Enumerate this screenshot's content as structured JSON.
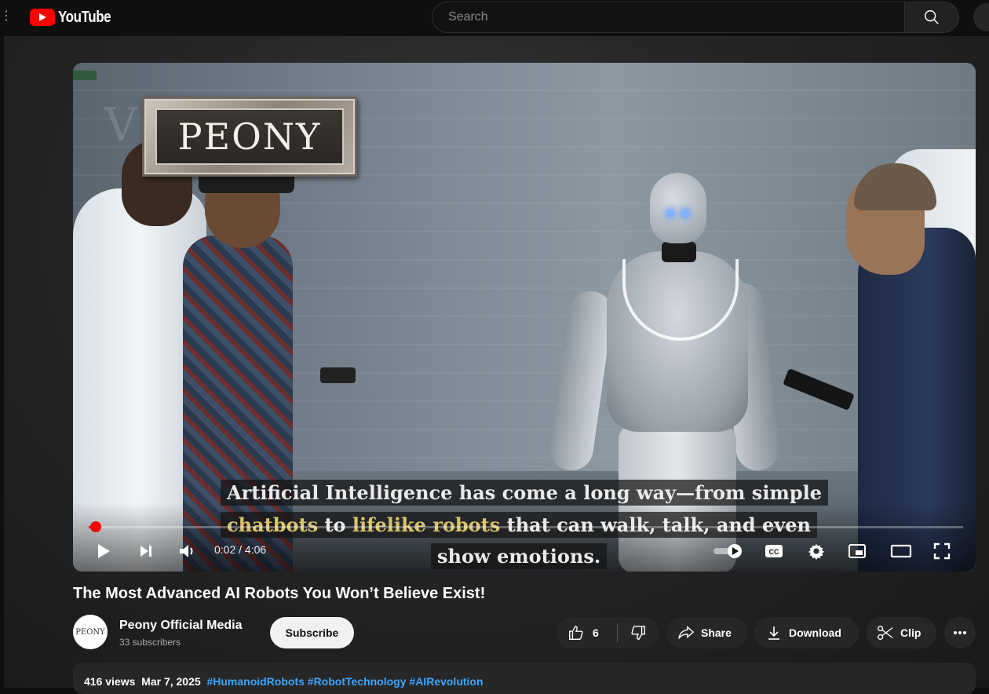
{
  "header": {
    "logo_text": "YouTube",
    "search_placeholder": "Search"
  },
  "video": {
    "overlay_logo_text": "PEONY",
    "captions": {
      "line1": "Artificial Intelligence has come a long way—from simple",
      "line2_part1": "chatbots",
      "line2_part2": " to ",
      "line2_part3": "lifelike robots",
      "line2_part4": " that can walk, talk, and even",
      "line3": "show emotions."
    },
    "time_display": "0:02 / 4:06",
    "progress_fraction": 0.008,
    "accent_color": "#ff0000"
  },
  "title": "The Most Advanced AI Robots You Won’t Believe Exist!",
  "channel": {
    "avatar_text": "PEONY",
    "name": "Peony Official Media",
    "subscribers": "33 subscribers",
    "subscribe_label": "Subscribe"
  },
  "actions": {
    "like_count": "6",
    "share_label": "Share",
    "download_label": "Download",
    "clip_label": "Clip"
  },
  "description": {
    "views": "416 views",
    "date": "Mar 7, 2025",
    "hashtags": "#HumanoidRobots #RobotTechnology #AIRevolution",
    "hashtag_color": "#3ea6ff"
  },
  "icons": [
    "menu-icon",
    "youtube-logo-icon",
    "search-icon",
    "mic-icon",
    "play-icon",
    "next-icon",
    "volume-icon",
    "autoplay-toggle-icon",
    "captions-icon",
    "settings-gear-icon",
    "miniplayer-icon",
    "theater-mode-icon",
    "fullscreen-icon",
    "thumbs-up-icon",
    "thumbs-down-icon",
    "share-arrow-icon",
    "download-icon",
    "scissors-icon",
    "more-dots-icon"
  ]
}
